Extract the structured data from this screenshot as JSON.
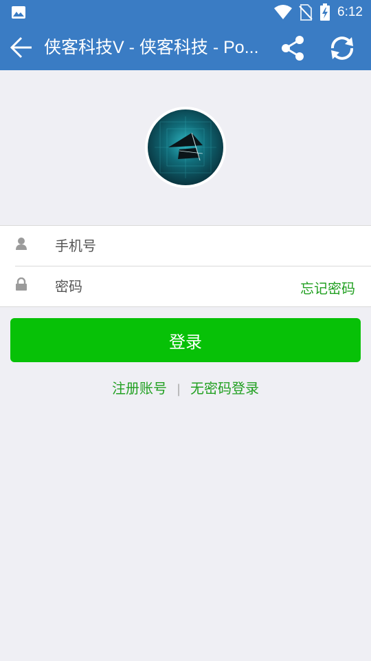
{
  "status_bar": {
    "time": "6:12",
    "icons": [
      "gallery-icon",
      "wifi-icon",
      "no-sim-icon",
      "battery-charging-icon"
    ]
  },
  "app_bar": {
    "title": "侠客科技V - 侠客科技 - Po...",
    "icons": [
      "back-arrow-icon",
      "share-icon",
      "refresh-icon"
    ]
  },
  "form": {
    "phone_placeholder": "手机号",
    "password_placeholder": "密码",
    "forgot_label": "忘记密码",
    "icons": [
      "user-icon",
      "lock-icon"
    ]
  },
  "login_button": "登录",
  "links": {
    "register": "注册账号",
    "separator": "|",
    "passwordless": "无密码登录"
  },
  "colors": {
    "app_bar": "#3a7cc4",
    "accent_green": "#07c107",
    "link_green": "#22a022",
    "background": "#efeff4"
  }
}
